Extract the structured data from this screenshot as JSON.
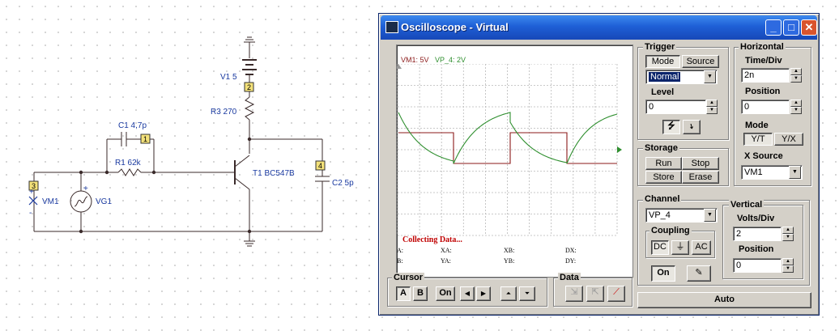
{
  "schematic": {
    "v1": "V1 5",
    "r3": "R3 270",
    "c1": "C1 4,7p",
    "r1": "R1 62k",
    "t1": "T1 BC547B",
    "c2": "C2 5p",
    "vm1": "VM1",
    "vg1": "VG1",
    "node1": "1",
    "node2": "2",
    "node3": "3",
    "node4": "4",
    "plus1": "+",
    "plus2": "+",
    "minus1": "-"
  },
  "window": {
    "title": "Oscilloscope - Virtual",
    "minimize": "_",
    "maximize": "□",
    "close": "✕"
  },
  "screen": {
    "legend_vm1": "VM1: 5V",
    "legend_vp4": "VP_4: 2V",
    "status": "Collecting Data...",
    "readouts": {
      "a": "A:",
      "xa": "XA:",
      "xb": "XB:",
      "dx": "DX:",
      "b": "B:",
      "ya": "YA:",
      "yb": "YB:",
      "dy": "DY:"
    },
    "colors": {
      "vm1": "#8b1a1a",
      "vp4": "#2f8f2f"
    }
  },
  "trigger": {
    "label": "Trigger",
    "mode_btn": "Mode",
    "source_btn": "Source",
    "mode_value": "Normal",
    "level_label": "Level",
    "level_value": "0",
    "rise_icon": "⭍",
    "fall_icon": "⭏"
  },
  "horizontal": {
    "label": "Horizontal",
    "time_div_label": "Time/Div",
    "time_div_value": "2n",
    "position_label": "Position",
    "position_value": "0",
    "mode_label": "Mode",
    "yt": "Y/T",
    "yx": "Y/X",
    "xsource_label": "X Source",
    "xsource_value": "VM1"
  },
  "storage": {
    "label": "Storage",
    "run": "Run",
    "stop": "Stop",
    "store": "Store",
    "erase": "Erase"
  },
  "channel": {
    "label": "Channel",
    "value": "VP_4",
    "coupling_label": "Coupling",
    "dc": "DC",
    "gnd": "⏚",
    "ac": "AC",
    "on": "On"
  },
  "vertical": {
    "label": "Vertical",
    "volts_div_label": "Volts/Div",
    "volts_div_value": "2",
    "position_label": "Position",
    "position_value": "0"
  },
  "cursor": {
    "label": "Cursor",
    "a": "A",
    "b": "B",
    "on": "On"
  },
  "data_group": {
    "label": "Data"
  },
  "auto_btn": "Auto"
}
